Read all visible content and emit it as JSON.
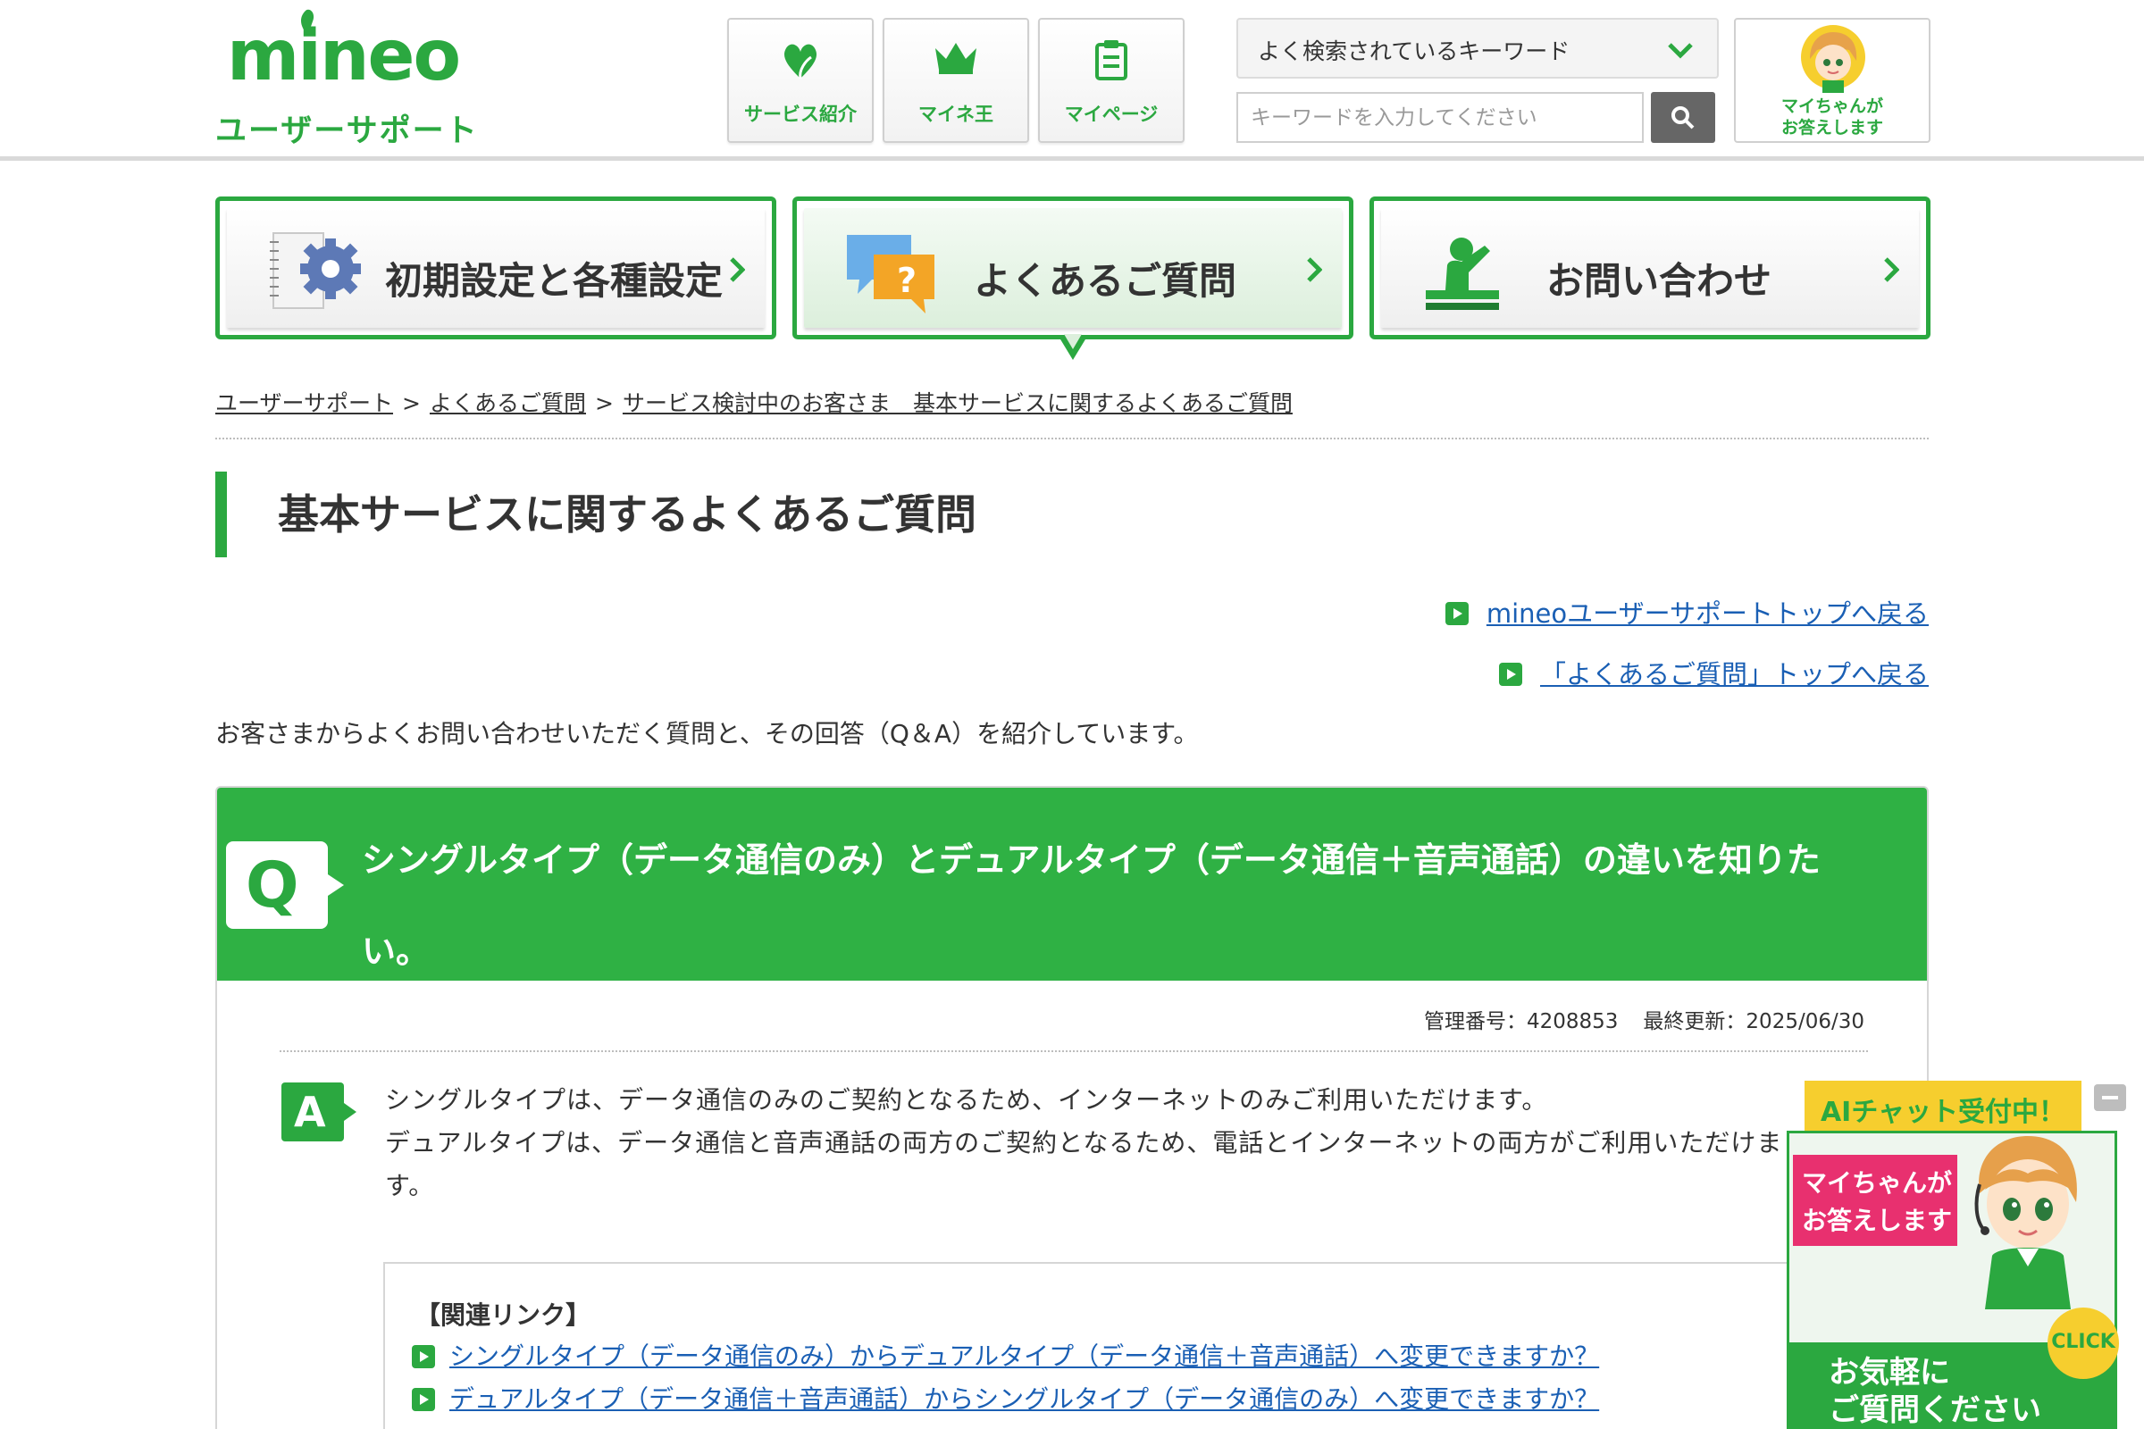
{
  "header": {
    "logo_text": "mineo",
    "logo_subtitle": "ユーザーサポート",
    "nav": [
      {
        "label": "サービス紹介",
        "icon": "heart-leaf-icon"
      },
      {
        "label": "マイネ王",
        "icon": "crown-icon"
      },
      {
        "label": "マイページ",
        "icon": "notepad-icon"
      }
    ],
    "keyword_select": "よく検索されているキーワード",
    "search_placeholder": "キーワードを入力してください",
    "assistant_line1": "マイちゃんが",
    "assistant_line2": "お答えします"
  },
  "tabs": [
    {
      "label": "初期設定と各種設定",
      "icon": "notebook-gear-icon"
    },
    {
      "label": "よくあるご質問",
      "icon": "question-bubble-icon"
    },
    {
      "label": "お問い合わせ",
      "icon": "operator-desk-icon"
    }
  ],
  "breadcrumb": [
    "ユーザーサポート",
    "よくあるご質問",
    "サービス検討中のお客さま　基本サービスに関するよくあるご質問"
  ],
  "breadcrumb_separator": ">",
  "page_title": "基本サービスに関するよくあるご質問",
  "back_links": [
    "mineoユーザーサポートトップへ戻る",
    "「よくあるご質問」トップへ戻る"
  ],
  "intro": "お客さまからよくお問い合わせいただく質問と、その回答（Q＆A）を紹介しています。",
  "qa": {
    "q_badge": "Q",
    "question": "シングルタイプ（データ通信のみ）とデュアルタイプ（データ通信＋音声通話）の違いを知りたい。",
    "management_no": "管理番号：4208853",
    "updated": "最終更新：2025/06/30",
    "a_badge": "A",
    "answer_line1": "シングルタイプは、データ通信のみのご契約となるため、インターネットのみご利用いただけます。",
    "answer_line2": "デュアルタイプは、データ通信と音声通話の両方のご契約となるため、電話とインターネットの両方がご利用いただけます。",
    "related_title": "【関連リンク】",
    "related_links": [
      "シングルタイプ（データ通信のみ）からデュアルタイプ（データ通信＋音声通話）へ変更できますか？",
      "デュアルタイプ（データ通信＋音声通話）からシングルタイプ（データ通信のみ）へ変更できますか？"
    ]
  },
  "chat_widget": {
    "ribbon": "AIチャット受付中！",
    "pink_line1": "マイちゃんが",
    "pink_line2": "お答えします",
    "click": "CLICK",
    "bottom_line1": "お気軽に",
    "bottom_line2": "ご質問ください"
  },
  "colors": {
    "brand_green": "#2ba840",
    "question_bg": "#2fb144",
    "link": "#1a5fb4",
    "ribbon_yellow": "#f6ce2e",
    "chat_pink": "#e8306f"
  }
}
